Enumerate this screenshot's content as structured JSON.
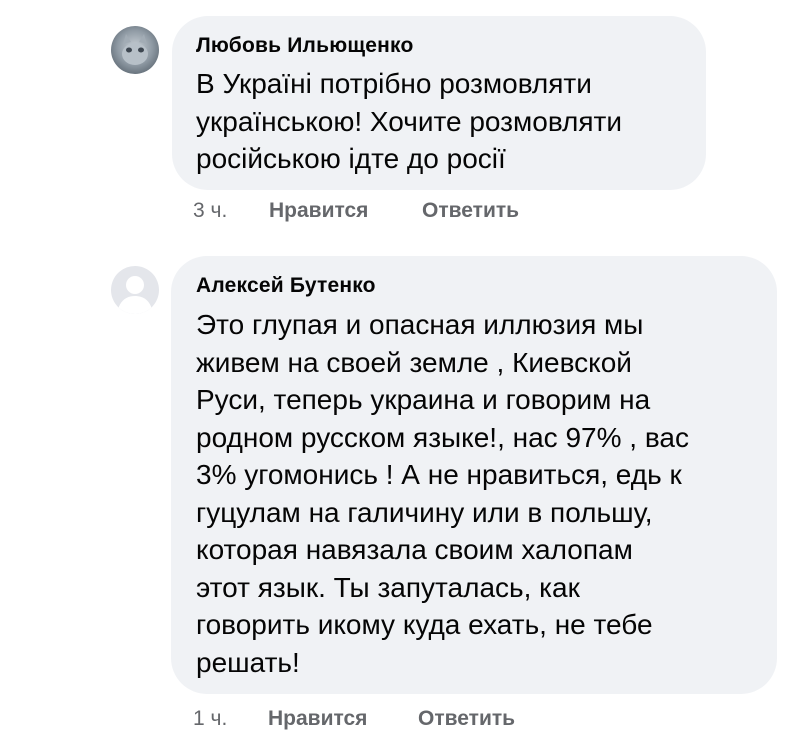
{
  "comments": [
    {
      "author": "Любовь Ильющенко",
      "lines": [
        "В Україні потрібно розмовляти",
        "українською! Хочите розмовляти",
        "російською ідте до росії"
      ],
      "time": "3 ч.",
      "like_label": "Нравится",
      "reply_label": "Ответить",
      "avatar_icon": "user-photo-avatar"
    },
    {
      "author": "Алексей Бутенко",
      "lines": [
        "Это глупая и опасная иллюзия мы",
        "живем на своей земле , Киевской",
        "Руси, теперь украина и говорим на",
        "родном русском языке!, нас 97% , вас",
        "3% угомонись ! А не нравиться, едь к",
        "гуцулам на галичину или в польшу,",
        "которая навязала своим халопам",
        "этот язык. Ты запуталась, как",
        "говорить икому куда ехать, не тебе",
        "решать!"
      ],
      "time": "1 ч.",
      "like_label": "Нравится",
      "reply_label": "Ответить",
      "avatar_icon": "default-user-avatar"
    }
  ],
  "colors": {
    "bubble": "#f0f2f5",
    "text": "#050505",
    "meta": "#65676b"
  }
}
